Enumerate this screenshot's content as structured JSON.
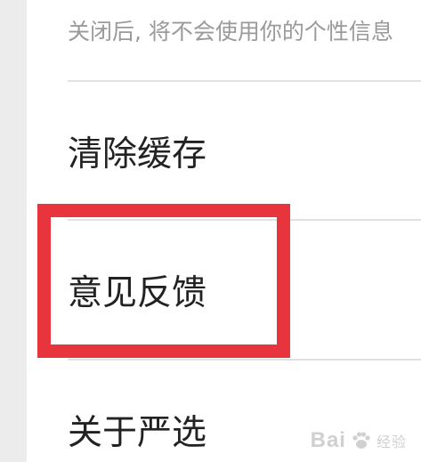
{
  "settings": {
    "personalization_description": "关闭后, 将不会使用你的个性信息",
    "items": [
      {
        "label": "清除缓存"
      },
      {
        "label": "意见反馈"
      },
      {
        "label": "关于严选"
      }
    ]
  },
  "annotation": {
    "highlight_color": "#e8353d"
  },
  "watermark": {
    "brand": "Bai",
    "icon": "paw-icon",
    "sub": "经验"
  },
  "colors": {
    "background": "#ececec",
    "panel": "#ffffff",
    "text_primary": "#222222",
    "text_secondary": "#9a9a9a",
    "divider": "#e1e1e1"
  }
}
